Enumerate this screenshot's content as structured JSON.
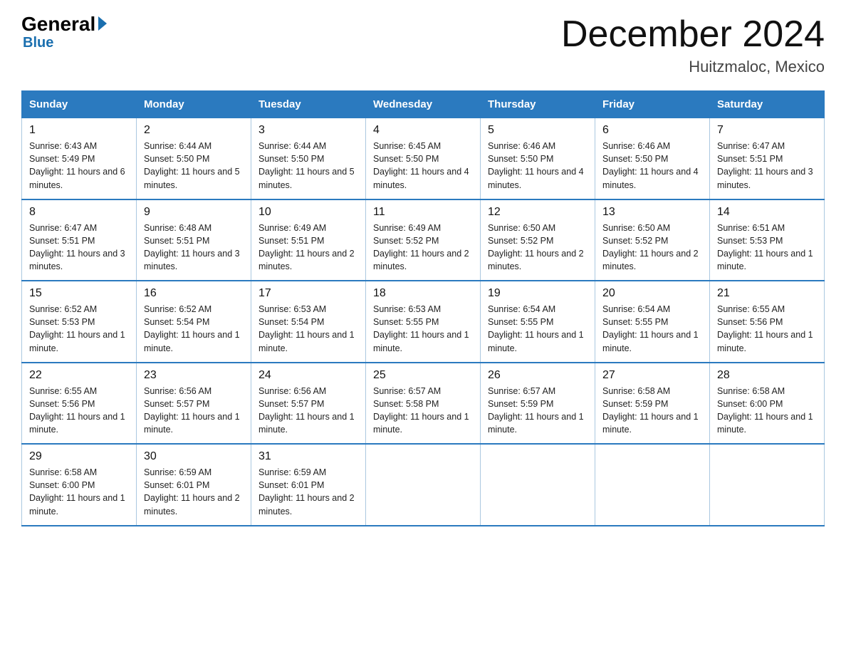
{
  "logo": {
    "general": "General",
    "blue": "Blue"
  },
  "header": {
    "title": "December 2024",
    "location": "Huitzmaloc, Mexico"
  },
  "calendar": {
    "days_of_week": [
      "Sunday",
      "Monday",
      "Tuesday",
      "Wednesday",
      "Thursday",
      "Friday",
      "Saturday"
    ],
    "weeks": [
      [
        {
          "day": "1",
          "sunrise": "6:43 AM",
          "sunset": "5:49 PM",
          "daylight": "11 hours and 6 minutes."
        },
        {
          "day": "2",
          "sunrise": "6:44 AM",
          "sunset": "5:50 PM",
          "daylight": "11 hours and 5 minutes."
        },
        {
          "day": "3",
          "sunrise": "6:44 AM",
          "sunset": "5:50 PM",
          "daylight": "11 hours and 5 minutes."
        },
        {
          "day": "4",
          "sunrise": "6:45 AM",
          "sunset": "5:50 PM",
          "daylight": "11 hours and 4 minutes."
        },
        {
          "day": "5",
          "sunrise": "6:46 AM",
          "sunset": "5:50 PM",
          "daylight": "11 hours and 4 minutes."
        },
        {
          "day": "6",
          "sunrise": "6:46 AM",
          "sunset": "5:50 PM",
          "daylight": "11 hours and 4 minutes."
        },
        {
          "day": "7",
          "sunrise": "6:47 AM",
          "sunset": "5:51 PM",
          "daylight": "11 hours and 3 minutes."
        }
      ],
      [
        {
          "day": "8",
          "sunrise": "6:47 AM",
          "sunset": "5:51 PM",
          "daylight": "11 hours and 3 minutes."
        },
        {
          "day": "9",
          "sunrise": "6:48 AM",
          "sunset": "5:51 PM",
          "daylight": "11 hours and 3 minutes."
        },
        {
          "day": "10",
          "sunrise": "6:49 AM",
          "sunset": "5:51 PM",
          "daylight": "11 hours and 2 minutes."
        },
        {
          "day": "11",
          "sunrise": "6:49 AM",
          "sunset": "5:52 PM",
          "daylight": "11 hours and 2 minutes."
        },
        {
          "day": "12",
          "sunrise": "6:50 AM",
          "sunset": "5:52 PM",
          "daylight": "11 hours and 2 minutes."
        },
        {
          "day": "13",
          "sunrise": "6:50 AM",
          "sunset": "5:52 PM",
          "daylight": "11 hours and 2 minutes."
        },
        {
          "day": "14",
          "sunrise": "6:51 AM",
          "sunset": "5:53 PM",
          "daylight": "11 hours and 1 minute."
        }
      ],
      [
        {
          "day": "15",
          "sunrise": "6:52 AM",
          "sunset": "5:53 PM",
          "daylight": "11 hours and 1 minute."
        },
        {
          "day": "16",
          "sunrise": "6:52 AM",
          "sunset": "5:54 PM",
          "daylight": "11 hours and 1 minute."
        },
        {
          "day": "17",
          "sunrise": "6:53 AM",
          "sunset": "5:54 PM",
          "daylight": "11 hours and 1 minute."
        },
        {
          "day": "18",
          "sunrise": "6:53 AM",
          "sunset": "5:55 PM",
          "daylight": "11 hours and 1 minute."
        },
        {
          "day": "19",
          "sunrise": "6:54 AM",
          "sunset": "5:55 PM",
          "daylight": "11 hours and 1 minute."
        },
        {
          "day": "20",
          "sunrise": "6:54 AM",
          "sunset": "5:55 PM",
          "daylight": "11 hours and 1 minute."
        },
        {
          "day": "21",
          "sunrise": "6:55 AM",
          "sunset": "5:56 PM",
          "daylight": "11 hours and 1 minute."
        }
      ],
      [
        {
          "day": "22",
          "sunrise": "6:55 AM",
          "sunset": "5:56 PM",
          "daylight": "11 hours and 1 minute."
        },
        {
          "day": "23",
          "sunrise": "6:56 AM",
          "sunset": "5:57 PM",
          "daylight": "11 hours and 1 minute."
        },
        {
          "day": "24",
          "sunrise": "6:56 AM",
          "sunset": "5:57 PM",
          "daylight": "11 hours and 1 minute."
        },
        {
          "day": "25",
          "sunrise": "6:57 AM",
          "sunset": "5:58 PM",
          "daylight": "11 hours and 1 minute."
        },
        {
          "day": "26",
          "sunrise": "6:57 AM",
          "sunset": "5:59 PM",
          "daylight": "11 hours and 1 minute."
        },
        {
          "day": "27",
          "sunrise": "6:58 AM",
          "sunset": "5:59 PM",
          "daylight": "11 hours and 1 minute."
        },
        {
          "day": "28",
          "sunrise": "6:58 AM",
          "sunset": "6:00 PM",
          "daylight": "11 hours and 1 minute."
        }
      ],
      [
        {
          "day": "29",
          "sunrise": "6:58 AM",
          "sunset": "6:00 PM",
          "daylight": "11 hours and 1 minute."
        },
        {
          "day": "30",
          "sunrise": "6:59 AM",
          "sunset": "6:01 PM",
          "daylight": "11 hours and 2 minutes."
        },
        {
          "day": "31",
          "sunrise": "6:59 AM",
          "sunset": "6:01 PM",
          "daylight": "11 hours and 2 minutes."
        },
        null,
        null,
        null,
        null
      ]
    ]
  }
}
